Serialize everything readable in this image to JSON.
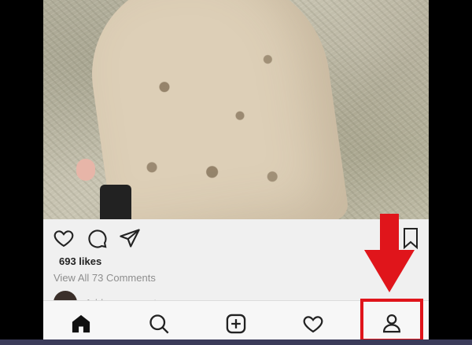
{
  "post": {
    "likes": "693 likes",
    "comments_link": "View All 73 Comments",
    "add_comment_placeholder": "Add a comment..."
  },
  "actions": [
    {
      "icon": "heart-outline-icon"
    },
    {
      "icon": "comment-icon"
    },
    {
      "icon": "share-icon"
    },
    {
      "icon": "bookmark-icon"
    }
  ],
  "nav": [
    {
      "icon": "home-icon",
      "active": true
    },
    {
      "icon": "search-icon"
    },
    {
      "icon": "add-post-icon"
    },
    {
      "icon": "activity-heart-icon"
    },
    {
      "icon": "profile-icon",
      "highlighted": true
    }
  ],
  "colors": {
    "annotation_red": "#e0151b",
    "icon": "#222222",
    "muted_text": "#8e8e8e"
  }
}
